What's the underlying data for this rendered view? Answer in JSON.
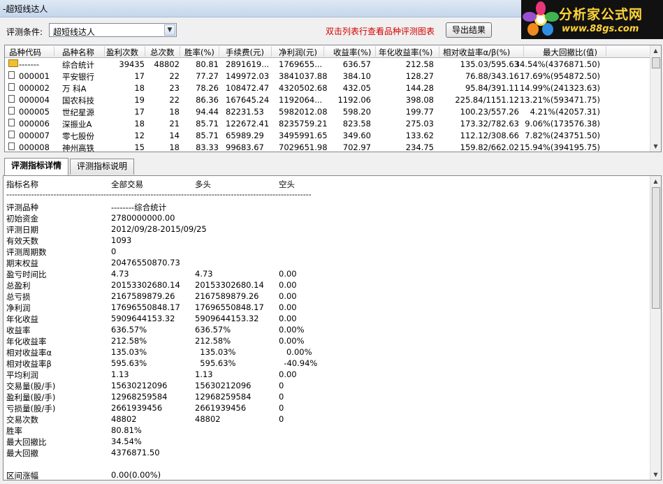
{
  "window": {
    "title": "-超短线达人"
  },
  "logo": {
    "line1": "分析家公式网",
    "line2": "www.88gs.com"
  },
  "toolbar": {
    "condition_label": "评测条件:",
    "condition_value": "超短线达人",
    "hint": "双击列表行查看品种评测图表",
    "export_label": "导出结果"
  },
  "grid": {
    "columns": [
      "品种代码",
      "品种名称",
      "盈利次数",
      "总次数",
      "胜率(%)",
      "手续费(元)",
      "净利润(元)",
      "收益率(%)",
      "年化收益率(%)",
      "相对收益率α/β(%)",
      "最大回撤比(值)"
    ],
    "rows": [
      {
        "code": "-------",
        "name": "综合统计",
        "wins": "39435",
        "total": "48802",
        "winrate": "80.81",
        "fee": "2891619...",
        "profit": "1769655...",
        "ret": "636.57",
        "annual": "212.58",
        "rel": "135.03/595.63",
        "dd": "34.54%(4376871.50)",
        "icon": "folder"
      },
      {
        "code": "000001",
        "name": "平安银行",
        "wins": "17",
        "total": "22",
        "winrate": "77.27",
        "fee": "149972.03",
        "profit": "3841037.88",
        "ret": "384.10",
        "annual": "128.27",
        "rel": "76.88/343.16",
        "dd": "17.69%(954872.50)",
        "icon": "file"
      },
      {
        "code": "000002",
        "name": "万  科A",
        "wins": "18",
        "total": "23",
        "winrate": "78.26",
        "fee": "108472.47",
        "profit": "4320502.68",
        "ret": "432.05",
        "annual": "144.28",
        "rel": "95.84/391.11",
        "dd": "14.99%(241323.63)",
        "icon": "file"
      },
      {
        "code": "000004",
        "name": "国农科技",
        "wins": "19",
        "total": "22",
        "winrate": "86.36",
        "fee": "167645.24",
        "profit": "1192064...",
        "ret": "1192.06",
        "annual": "398.08",
        "rel": "225.84/1151.12",
        "dd": "13.21%(593471.75)",
        "icon": "file"
      },
      {
        "code": "000005",
        "name": "世纪星源",
        "wins": "17",
        "total": "18",
        "winrate": "94.44",
        "fee": "82231.53",
        "profit": "5982012.08",
        "ret": "598.20",
        "annual": "199.77",
        "rel": "100.23/557.26",
        "dd": "4.21%(42057.31)",
        "icon": "file"
      },
      {
        "code": "000006",
        "name": "深振业A",
        "wins": "18",
        "total": "21",
        "winrate": "85.71",
        "fee": "122672.41",
        "profit": "8235759.21",
        "ret": "823.58",
        "annual": "275.03",
        "rel": "173.32/782.63",
        "dd": "9.06%(173576.38)",
        "icon": "file"
      },
      {
        "code": "000007",
        "name": "零七股份",
        "wins": "12",
        "total": "14",
        "winrate": "85.71",
        "fee": "65989.29",
        "profit": "3495991.65",
        "ret": "349.60",
        "annual": "133.62",
        "rel": "112.12/308.66",
        "dd": "7.82%(243751.50)",
        "icon": "file"
      },
      {
        "code": "000008",
        "name": "神州高铁",
        "wins": "15",
        "total": "18",
        "winrate": "83.33",
        "fee": "99683.67",
        "profit": "7029651.98",
        "ret": "702.97",
        "annual": "234.75",
        "rel": "159.82/662.02",
        "dd": "15.94%(394195.75)",
        "icon": "file"
      }
    ]
  },
  "tabs": [
    {
      "label": "评测指标详情",
      "active": true
    },
    {
      "label": "评测指标说明",
      "active": false
    }
  ],
  "detail": {
    "headers": [
      "指标名称",
      "全部交易",
      "多头",
      "空头"
    ],
    "separator": "--------------------------------------------------------------------------------------------------------------",
    "rows": [
      [
        "评测品种",
        "--------综合统计",
        "",
        ""
      ],
      [
        "初始资金",
        "2780000000.00",
        "",
        ""
      ],
      [
        "评测日期",
        "2012/09/28-2015/09/25",
        "",
        ""
      ],
      [
        "有效天数",
        "1093",
        "",
        ""
      ],
      [
        "评测周期数",
        "0",
        "",
        ""
      ],
      [
        "期末权益",
        "20476550870.73",
        "",
        ""
      ],
      [
        "盈亏时间比",
        "4.73",
        "4.73",
        "0.00"
      ],
      [
        "总盈利",
        "20153302680.14",
        "20153302680.14",
        "0.00"
      ],
      [
        "总亏损",
        "2167589879.26",
        "2167589879.26",
        "0.00"
      ],
      [
        "净利润",
        "17696550848.17",
        "17696550848.17",
        "0.00"
      ],
      [
        "年化收益",
        "5909644153.32",
        "5909644153.32",
        "0.00"
      ],
      [
        "收益率",
        "636.57%",
        "636.57%",
        "0.00%"
      ],
      [
        "年化收益率",
        "212.58%",
        "212.58%",
        "0.00%"
      ],
      [
        "相对收益率α",
        "135.03%",
        "  135.03%",
        "   0.00%"
      ],
      [
        "相对收益率β",
        "595.63%",
        "  595.63%",
        "  -40.94%"
      ],
      [
        "平均利润",
        "1.13",
        "1.13",
        "0.00"
      ],
      [
        "交易量(股/手)",
        "15630212096",
        "15630212096",
        "0"
      ],
      [
        "盈利量(股/手)",
        "12968259584",
        "12968259584",
        "0"
      ],
      [
        "亏损量(股/手)",
        "2661939456",
        "2661939456",
        "0"
      ],
      [
        "交易次数",
        "48802",
        "48802",
        "0"
      ],
      [
        "胜率",
        "80.81%",
        "",
        ""
      ],
      [
        "最大回撤比",
        "34.54%",
        "",
        ""
      ],
      [
        "最大回撤",
        "4376871.50",
        "",
        ""
      ],
      [
        "",
        "",
        " ",
        ""
      ],
      [
        "区间涨幅",
        "0.00(0.00%)",
        "",
        ""
      ]
    ]
  }
}
